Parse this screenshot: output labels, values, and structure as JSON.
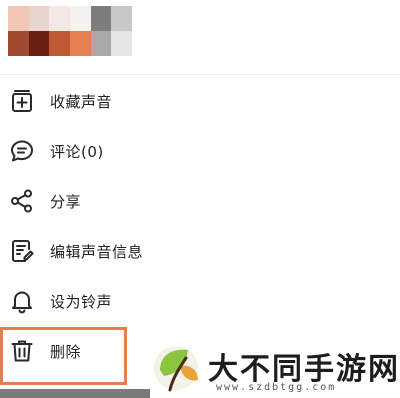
{
  "header": {
    "mosaic_colors": [
      "#f0c6b4",
      "#e7d4cd",
      "#f3e8e3",
      "#f5f1ef",
      "#7d7d7d",
      "#c8c8c8",
      "#a04a32",
      "#6b1f12",
      "#c05a35",
      "#e87f52",
      "#a9a9a9",
      "#e4e4e4"
    ]
  },
  "menu": {
    "items": [
      {
        "label": "收藏声音",
        "icon": "add-to-collection-icon"
      },
      {
        "label": "评论(0)",
        "icon": "comment-icon"
      },
      {
        "label": "分享",
        "icon": "share-icon"
      },
      {
        "label": "编辑声音信息",
        "icon": "edit-document-icon"
      },
      {
        "label": "设为铃声",
        "icon": "bell-icon"
      },
      {
        "label": "删除",
        "icon": "trash-icon"
      }
    ]
  },
  "highlight_color": "#e57e4f",
  "watermark": {
    "title": "大不同手游网",
    "url": "www.szdbtgg.com",
    "logo_colors": [
      "#8cc63f",
      "#e8a23a",
      "#4a2c12"
    ]
  }
}
